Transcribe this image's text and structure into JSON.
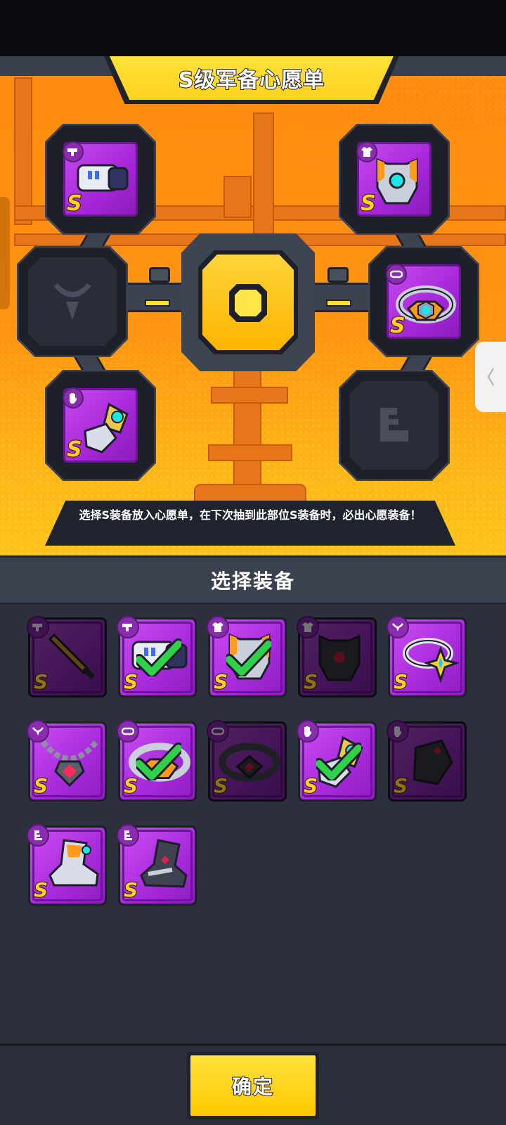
{
  "wishlist": {
    "title": "S级军备心愿单",
    "description": "选择S装备放入心愿单，在下次抽到此部位S装备时，必出心愿装备！",
    "slots": [
      {
        "part": "weapon",
        "part_icon": "blaster-icon",
        "filled": true,
        "item_icon": "blaster-gauntlet-icon",
        "rank": "S"
      },
      {
        "part": "armor",
        "part_icon": "shirt-icon",
        "filled": true,
        "item_icon": "mech-armor-icon",
        "rank": "S"
      },
      {
        "part": "necklace",
        "part_icon": "necklace-icon",
        "filled": false,
        "item_icon": "necklace-placeholder-icon",
        "rank": ""
      },
      {
        "part": "belt",
        "part_icon": "belt-icon",
        "filled": true,
        "item_icon": "tech-belt-icon",
        "rank": "S"
      },
      {
        "part": "gloves",
        "part_icon": "glove-icon",
        "filled": true,
        "item_icon": "tech-glove-icon",
        "rank": "S"
      },
      {
        "part": "boots",
        "part_icon": "boot-icon",
        "filled": false,
        "item_icon": "boot-placeholder-icon",
        "rank": ""
      }
    ]
  },
  "choose": {
    "title": "选择装备",
    "items": [
      {
        "name": "sword",
        "part_icon": "blaster-icon",
        "rank": "S",
        "selected": false,
        "dim": true
      },
      {
        "name": "blaster",
        "part_icon": "blaster-icon",
        "rank": "S",
        "selected": true,
        "dim": false
      },
      {
        "name": "mech-armor",
        "part_icon": "shirt-icon",
        "rank": "S",
        "selected": true,
        "dim": false
      },
      {
        "name": "dark-armor",
        "part_icon": "shirt-icon",
        "rank": "S",
        "selected": false,
        "dim": true
      },
      {
        "name": "star-ring",
        "part_icon": "necklace-icon",
        "rank": "S",
        "selected": false,
        "dim": false
      },
      {
        "name": "gem-chain",
        "part_icon": "necklace-icon",
        "rank": "S",
        "selected": false,
        "dim": false
      },
      {
        "name": "tech-belt",
        "part_icon": "belt-icon",
        "rank": "S",
        "selected": true,
        "dim": false
      },
      {
        "name": "dark-belt",
        "part_icon": "belt-icon",
        "rank": "S",
        "selected": false,
        "dim": true
      },
      {
        "name": "tech-glove",
        "part_icon": "glove-icon",
        "rank": "S",
        "selected": true,
        "dim": false
      },
      {
        "name": "dark-glove",
        "part_icon": "glove-icon",
        "rank": "S",
        "selected": false,
        "dim": true
      },
      {
        "name": "tech-boots",
        "part_icon": "boot-icon",
        "rank": "S",
        "selected": false,
        "dim": false
      },
      {
        "name": "dark-boots",
        "part_icon": "boot-icon",
        "rank": "S",
        "selected": false,
        "dim": false
      }
    ]
  },
  "footer": {
    "confirm_label": "确定"
  },
  "colors": {
    "accent": "#ffd21f",
    "item_purple": "#a72adb",
    "panel_orange": "#ff8a10",
    "check_green": "#2fd14b"
  }
}
